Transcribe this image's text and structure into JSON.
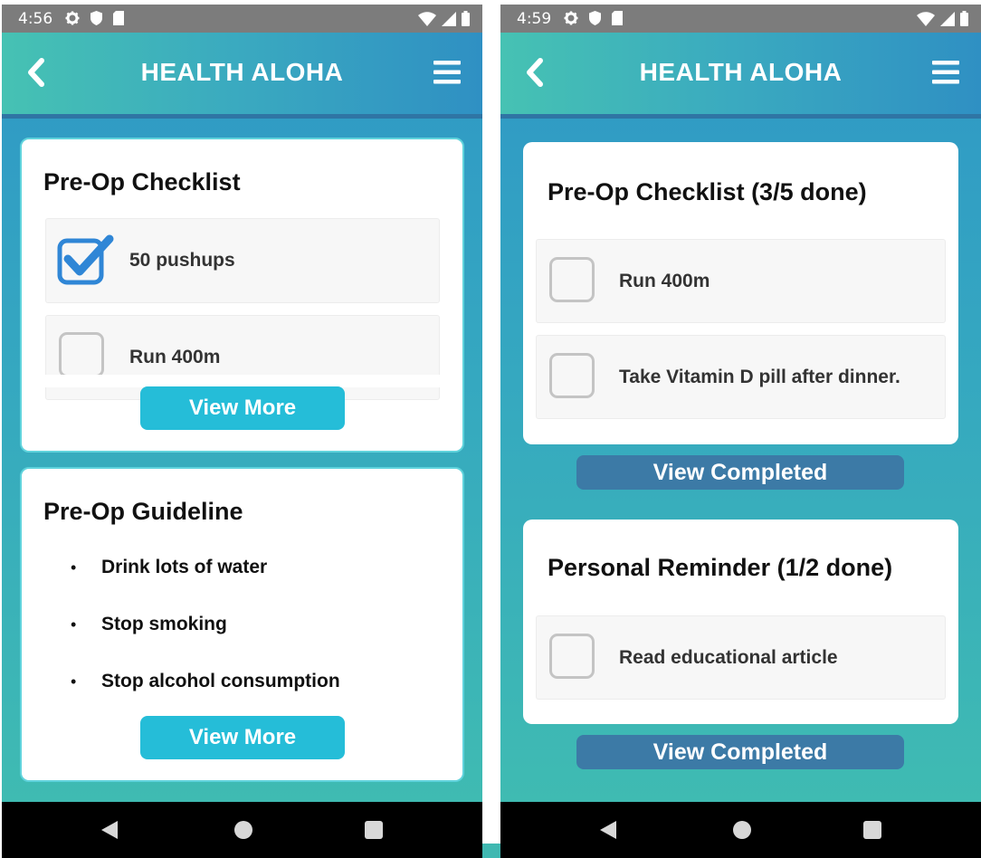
{
  "left": {
    "status": {
      "time": "4:56"
    },
    "appbar": {
      "title": "HEALTH ALOHA"
    },
    "checklist_card": {
      "title": "Pre-Op Checklist",
      "items": [
        {
          "label": "50 pushups",
          "checked": true
        },
        {
          "label": "Run 400m",
          "checked": false
        }
      ],
      "button": "View More"
    },
    "guideline_card": {
      "title": "Pre-Op Guideline",
      "bullets": [
        "Drink lots of water",
        "Stop smoking",
        "Stop alcohol consumption"
      ],
      "bullet_symbol": "•",
      "button": "View More"
    }
  },
  "right": {
    "status": {
      "time": "4:59"
    },
    "appbar": {
      "title": "HEALTH ALOHA"
    },
    "checklist_card": {
      "title": "Pre-Op Checklist (3/5 done)",
      "items": [
        {
          "label": "Run 400m",
          "checked": false
        },
        {
          "label": "Take Vitamin D pill after dinner.",
          "checked": false
        }
      ]
    },
    "checklist_button": "View Completed",
    "reminder_card": {
      "title": "Personal Reminder  (1/2 done)",
      "items": [
        {
          "label": "Read educational article",
          "checked": false
        }
      ]
    },
    "reminder_button": "View Completed"
  },
  "icons": {
    "status_left": [
      "gear-icon",
      "shield-icon",
      "sd-card-icon"
    ],
    "status_right": [
      "wifi-icon",
      "signal-icon",
      "battery-icon"
    ],
    "appbar": [
      "back-arrow-icon",
      "hamburger-menu-icon"
    ],
    "nav": [
      "nav-back-icon",
      "nav-home-icon",
      "nav-recents-icon"
    ]
  },
  "colors": {
    "accent_button": "#25bdd8",
    "completed_button": "#3c7aa6",
    "check_blue": "#2f86d6",
    "status_bar": "#7c7c7c"
  }
}
